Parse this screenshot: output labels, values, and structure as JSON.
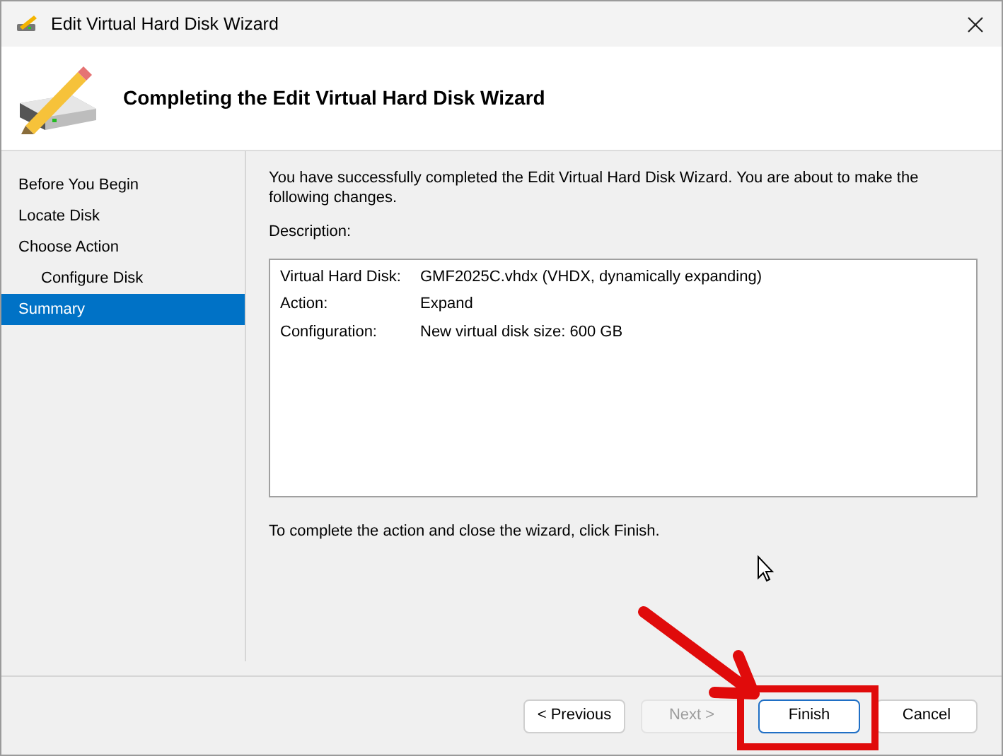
{
  "window": {
    "title": "Edit Virtual Hard Disk Wizard"
  },
  "header": {
    "title": "Completing the Edit Virtual Hard Disk Wizard"
  },
  "steps": [
    {
      "label": "Before You Begin",
      "selected": false
    },
    {
      "label": "Locate Disk",
      "selected": false
    },
    {
      "label": "Choose Action",
      "selected": false,
      "children": [
        {
          "label": "Configure Disk",
          "selected": false
        }
      ]
    },
    {
      "label": "Summary",
      "selected": true
    }
  ],
  "summary": {
    "intro": "You have successfully completed the Edit Virtual Hard Disk Wizard. You are about to make the following changes.",
    "description_label": "Description:",
    "rows": [
      {
        "label": "Virtual Hard Disk:",
        "value": "GMF2025C.vhdx (VHDX, dynamically expanding)"
      },
      {
        "label": "Action:",
        "value": "Expand"
      },
      {
        "label": "Configuration:",
        "value": "New virtual disk size: 600 GB"
      }
    ],
    "note": "To complete the action and close the wizard, click Finish."
  },
  "buttons": [
    {
      "label": "< Previous",
      "disabled": false,
      "default": false
    },
    {
      "label": "Next >",
      "disabled": true,
      "default": false
    },
    {
      "label": "Finish",
      "disabled": false,
      "default": true
    },
    {
      "label": "Cancel",
      "disabled": false,
      "default": false
    }
  ]
}
